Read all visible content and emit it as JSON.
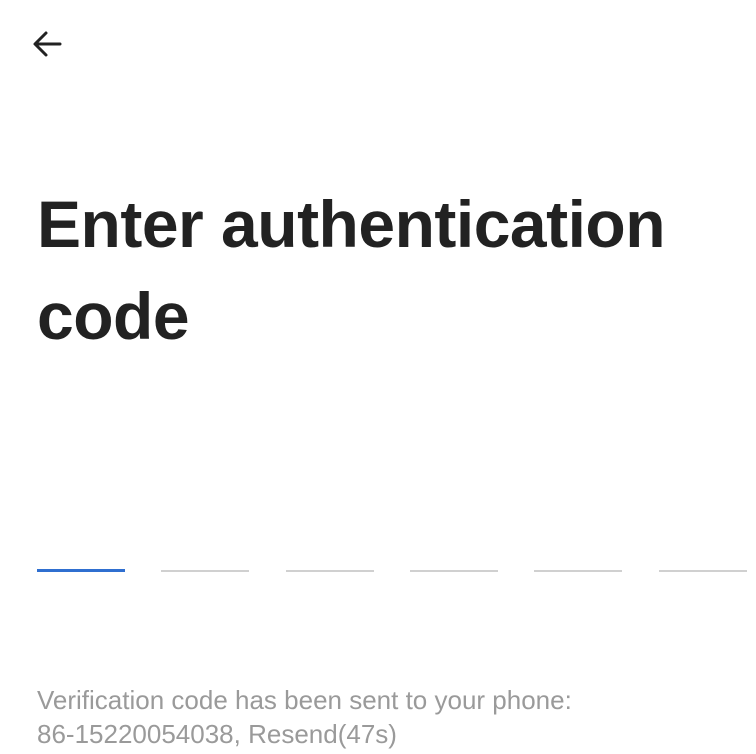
{
  "header": {
    "back_icon": "arrow-left-icon"
  },
  "title": "Enter authentication code",
  "code_input": {
    "length": 6,
    "active_index": 0,
    "active_color": "#2f6fd0",
    "inactive_color": "#d0d0d0"
  },
  "info": {
    "message": "Verification code has been sent to your phone:",
    "phone": "86-15220054038",
    "separator": ", ",
    "resend_label": "Resend(47s)"
  }
}
